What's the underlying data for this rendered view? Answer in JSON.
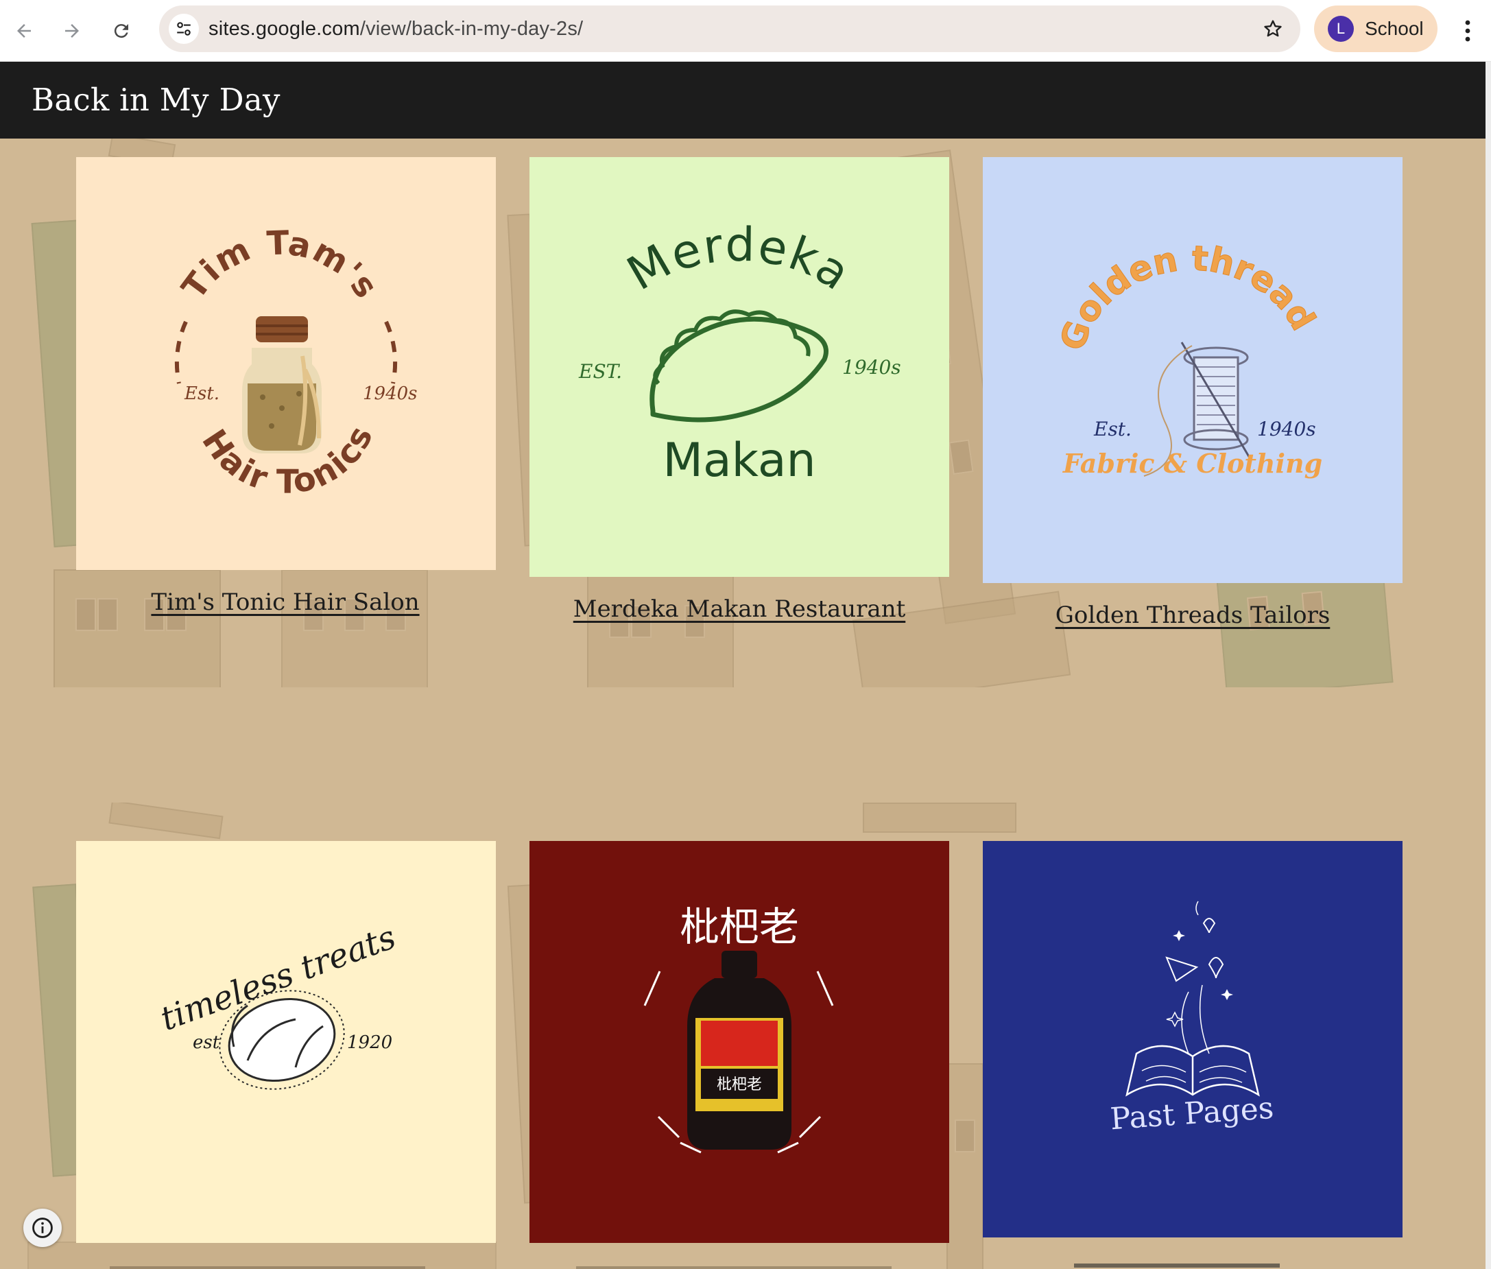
{
  "browser": {
    "url_host": "sites.google.com",
    "url_path": "/view/back-in-my-day-2s/",
    "profile_initial": "L",
    "profile_name": "School"
  },
  "site": {
    "title": "Back in My Day"
  },
  "cards": [
    {
      "link": "Tim's Tonic Hair Salon",
      "bg": "#fee6c6",
      "logo_top": "Tim Tam's",
      "logo_bottom": "Hair Tonics",
      "logo_est": "Est.",
      "logo_year": "1940s"
    },
    {
      "link": "Merdeka Makan Restaurant",
      "bg": "#e1f7c1",
      "logo_top": "Merdeka",
      "logo_bottom": "Makan",
      "logo_est": "EST.",
      "logo_year": "1940s"
    },
    {
      "link": "Golden Threads Tailors",
      "bg": "#c8d8f7",
      "logo_top": "Golden threads",
      "logo_bottom": "Fabric & Clothing",
      "logo_est": "Est.",
      "logo_year": "1940s"
    },
    {
      "link": "",
      "bg": "#fff2c9",
      "logo_top": "timeless treats",
      "logo_est": "est",
      "logo_year": "1920"
    },
    {
      "link": "",
      "bg": "#72110c",
      "logo_top": "枇杷老",
      "logo_label": "枇杷老"
    },
    {
      "link": "",
      "bg": "#232f88",
      "logo_bottom": "Past Pages"
    }
  ],
  "colors": {
    "tonic_brown": "#7a3e25",
    "merdeka_green": "#2f6a2c",
    "golden_orange": "#f0a24a",
    "golden_navy": "#23306b"
  }
}
